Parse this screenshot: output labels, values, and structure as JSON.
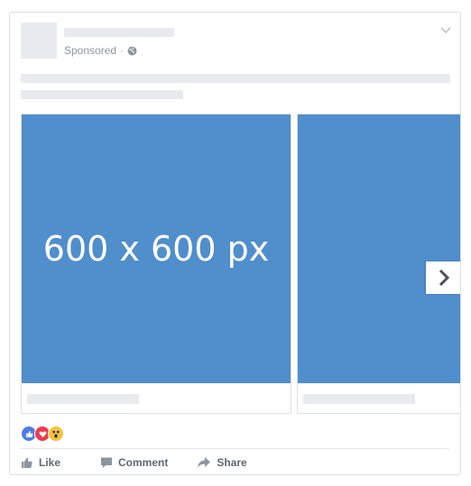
{
  "post": {
    "sponsored_label": "Sponsored",
    "sponsored_separator": "·"
  },
  "carousel": {
    "cards": [
      {
        "image_label": "600 x 600 px"
      },
      {
        "image_label": ""
      }
    ]
  },
  "actions": {
    "like": "Like",
    "comment": "Comment",
    "share": "Share"
  },
  "colors": {
    "image_placeholder": "#508ecc",
    "skeleton": "#e9eaed",
    "like_blue": "#4a7ce8",
    "love_red": "#f0394d",
    "wow_yellow": "#f7c33b"
  },
  "icons": [
    "globe-icon",
    "chevron-down-icon",
    "chevron-right-icon",
    "like-reaction-icon",
    "love-reaction-icon",
    "wow-reaction-icon",
    "thumbs-up-icon",
    "comment-icon",
    "share-icon"
  ]
}
